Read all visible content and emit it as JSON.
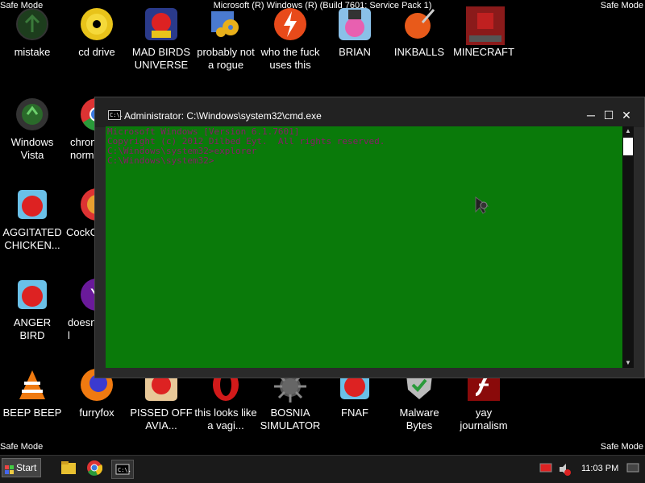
{
  "overlay": {
    "safe_mode": "Safe Mode",
    "build": "Microsoft (R) Windows (R) (Build 7601: Service Pack 1)"
  },
  "icons": [
    {
      "label": "mistake"
    },
    {
      "label": "cd drive"
    },
    {
      "label": "MAD BIRDS UNIVERSE"
    },
    {
      "label": "probably not a rogue"
    },
    {
      "label": "who the fuck uses this"
    },
    {
      "label": "BRIAN"
    },
    {
      "label": "INKBALLS"
    },
    {
      "label": "MINECRAFT"
    },
    {
      "label": "Windows Vista"
    },
    {
      "label": "chron norm"
    },
    {
      "label": "AGGITATED CHICKEN..."
    },
    {
      "label": "CockC"
    },
    {
      "label": "ANGER BIRD"
    },
    {
      "label": "doesn l"
    },
    {
      "label": "BEEP BEEP"
    },
    {
      "label": "furryfox"
    },
    {
      "label": "PISSED OFF AVIA..."
    },
    {
      "label": "this looks like a vagi..."
    },
    {
      "label": "BOSNIA SIMULATOR"
    },
    {
      "label": "FNAF"
    },
    {
      "label": "Malware Bytes"
    },
    {
      "label": "yay journalism"
    }
  ],
  "cmd": {
    "title": "Administrator: C:\\Windows\\system32\\cmd.exe",
    "icon_text": "C:\\.",
    "lines": [
      "Microsoft Windows [Version 6.1.7601]",
      "Copyright (c) 2012 Dilbed Eyt.  All rights reserved.",
      "",
      "C:\\Windows\\system32>explorer",
      "",
      "C:\\Windows\\system32>"
    ],
    "min_label": "─",
    "max_label": "☐",
    "close_label": "✕"
  },
  "taskbar": {
    "start_label": "Start",
    "clock": "11:03 PM"
  },
  "colors": {
    "console_bg": "#0a7a0a",
    "console_text": "#8a1a6a"
  }
}
